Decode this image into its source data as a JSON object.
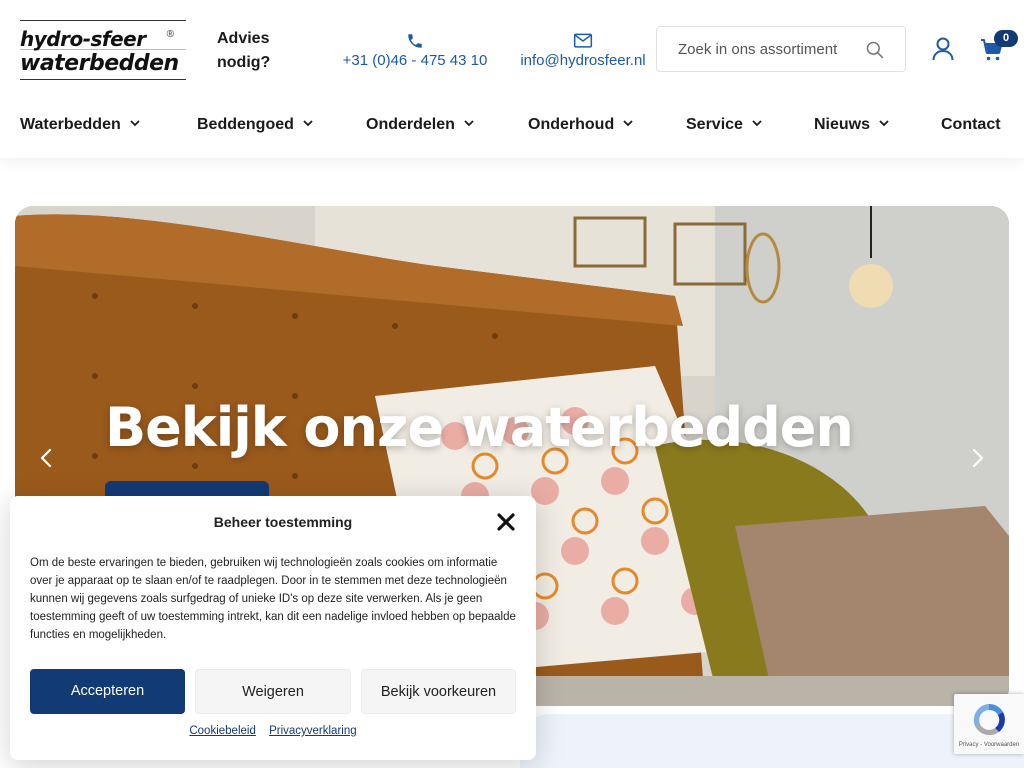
{
  "header": {
    "logo": {
      "line1": "hydro-sfeer",
      "line2": "waterbedden",
      "mark": "®"
    },
    "advies": {
      "line1": "Advies",
      "line2": "nodig?"
    },
    "phone": {
      "icon": "phone-icon",
      "text": "+31 (0)46 - 475 43 10"
    },
    "email": {
      "icon": "mail-icon",
      "text": "info@hydrosfeer.nl"
    },
    "search": {
      "placeholder": "Zoek in ons assortiment",
      "value": "",
      "icon": "search-icon"
    },
    "account_icon": "user-icon",
    "cart": {
      "icon": "cart-icon",
      "count": "0"
    }
  },
  "nav": {
    "items": [
      {
        "label": "Waterbedden",
        "has_dropdown": true
      },
      {
        "label": "Beddengoed",
        "has_dropdown": true
      },
      {
        "label": "Onderdelen",
        "has_dropdown": true
      },
      {
        "label": "Onderhoud",
        "has_dropdown": true
      },
      {
        "label": "Service",
        "has_dropdown": true
      },
      {
        "label": "Nieuws",
        "has_dropdown": true
      },
      {
        "label": "Contact",
        "has_dropdown": false
      }
    ]
  },
  "hero": {
    "title": "Bekijk onze waterbedden",
    "prev_icon": "chevron-left-icon",
    "next_icon": "chevron-right-icon"
  },
  "consent": {
    "title": "Beheer toestemming",
    "body": "Om de beste ervaringen te bieden, gebruiken wij technologieën zoals cookies om informatie over je apparaat op te slaan en/of te raadplegen. Door in te stemmen met deze technologieën kunnen wij gegevens zoals surfgedrag of unieke ID's op deze site verwerken. Als je geen toestemming geeft of uw toestemming intrekt, kan dit een nadelige invloed hebben op bepaalde functies en mogelijkheden.",
    "accept_label": "Accepteren",
    "deny_label": "Weigeren",
    "prefs_label": "Bekijk voorkeuren",
    "links": [
      "Cookiebeleid",
      "Privacyverklaring"
    ]
  },
  "recaptcha": {
    "text": "Privacy - Voorwaarden"
  },
  "colors": {
    "brand_blue": "#123a75",
    "link_blue": "#1d5aa8",
    "text": "#1b1b1b"
  }
}
